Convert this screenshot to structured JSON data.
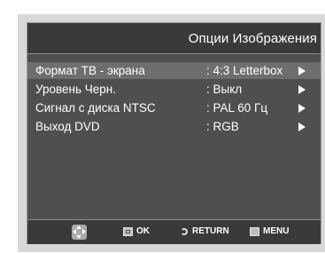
{
  "header": {
    "title": "Опции Изображения"
  },
  "menu": {
    "items": [
      {
        "label": "Формат ТВ - экрана",
        "value": ": 4:3 Letterbox",
        "selected": true
      },
      {
        "label": "Уровень  Черн.",
        "value": ": Выкл",
        "selected": false
      },
      {
        "label": "Сигнал с диска NTSC",
        "value": ": PAL 60 Гц",
        "selected": false
      },
      {
        "label": "Выход DVD",
        "value": ": RGB",
        "selected": false
      }
    ]
  },
  "footer": {
    "nav_icon": "dpad-icon",
    "ok_label": "OK",
    "return_label": "RETURN",
    "menu_label": "MENU"
  }
}
